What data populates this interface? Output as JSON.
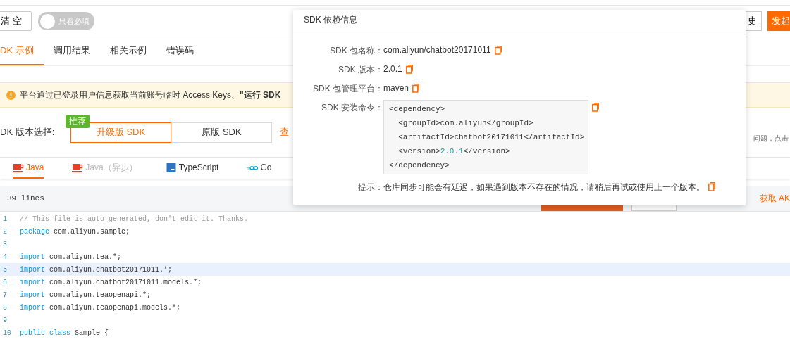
{
  "toolbar": {
    "clear_button": "清 空",
    "toggle": {
      "label": "只看必填",
      "on": false
    },
    "history_button": "史",
    "send_button": "发起"
  },
  "tabs": [
    {
      "label": "DK 示例",
      "selected": true
    },
    {
      "label": "调用结果",
      "selected": false
    },
    {
      "label": "相关示例",
      "selected": false
    },
    {
      "label": "错误码",
      "selected": false
    }
  ],
  "alert": {
    "text": "平台通过已登录用户信息获取当前账号临时 Access Keys、**\"运行 SDK**"
  },
  "sdk_version": {
    "label": "DK 版本选择:",
    "badge": "推荐",
    "options": [
      {
        "label": "升级版 SDK",
        "selected": true
      },
      {
        "label": "原版 SDK",
        "selected": false
      }
    ],
    "link": "查",
    "note": "问题，点击"
  },
  "languages": [
    {
      "label": "Java",
      "selected": true,
      "disabled": false,
      "kind": "java"
    },
    {
      "label": "Java（异步）",
      "selected": false,
      "disabled": true,
      "kind": "java"
    },
    {
      "label": "TypeScript",
      "selected": false,
      "disabled": false,
      "kind": "typescript"
    },
    {
      "label": "Go",
      "selected": false,
      "disabled": false,
      "kind": "go"
    }
  ],
  "code_header": {
    "line_count": "39 lines",
    "get_ak_link": "获取 AK"
  },
  "code": [
    {
      "number": "1",
      "highlighted": false,
      "tokens": [
        {
          "kind": "comment",
          "text": "// This file is auto-generated, don't edit it. Thanks."
        }
      ]
    },
    {
      "number": "2",
      "highlighted": false,
      "tokens": [
        {
          "kind": "keyword",
          "text": "package"
        },
        {
          "kind": "plain",
          "text": " com.aliyun.sample;"
        }
      ]
    },
    {
      "number": "3",
      "highlighted": false
    },
    {
      "number": "4",
      "highlighted": false,
      "tokens": [
        {
          "kind": "keyword",
          "text": "import"
        },
        {
          "kind": "plain",
          "text": " com.aliyun.tea.*;"
        }
      ]
    },
    {
      "number": "5",
      "highlighted": true,
      "tokens": [
        {
          "kind": "keyword",
          "text": "import"
        },
        {
          "kind": "plain",
          "text": " com.aliyun.chatbot20171011.*;"
        }
      ]
    },
    {
      "number": "6",
      "highlighted": false,
      "tokens": [
        {
          "kind": "keyword",
          "text": "import"
        },
        {
          "kind": "plain",
          "text": " com.aliyun.chatbot20171011.models.*;"
        }
      ]
    },
    {
      "number": "7",
      "highlighted": false,
      "tokens": [
        {
          "kind": "keyword",
          "text": "import"
        },
        {
          "kind": "plain",
          "text": " com.aliyun.teaopenapi.*;"
        }
      ]
    },
    {
      "number": "8",
      "highlighted": false,
      "tokens": [
        {
          "kind": "keyword",
          "text": "import"
        },
        {
          "kind": "plain",
          "text": " com.aliyun.teaopenapi.models.*;"
        }
      ]
    },
    {
      "number": "9",
      "highlighted": false
    },
    {
      "number": "10",
      "highlighted": false,
      "tokens": [
        {
          "kind": "keyword",
          "text": "public class"
        },
        {
          "kind": "plain",
          "text": " Sample {"
        }
      ]
    }
  ],
  "popover": {
    "title": "SDK 依赖信息",
    "rows": [
      {
        "kind": "text",
        "label": "SDK 包名称：",
        "value": "com.aliyun/chatbot20171011"
      },
      {
        "kind": "text",
        "label": "SDK 版本：",
        "value": "2.0.1"
      },
      {
        "kind": "text",
        "label": "SDK 包管理平台：",
        "value": "maven"
      },
      {
        "kind": "code",
        "label": "SDK 安装命令：",
        "lines": [
          [
            {
              "kind": "plain",
              "text": "<dependency>"
            }
          ],
          [
            {
              "kind": "plain",
              "text": "  <groupId>com.aliyun</groupId>"
            }
          ],
          [
            {
              "kind": "plain",
              "text": "  <artifactId>chatbot20171011</artifactId>"
            }
          ],
          [
            {
              "kind": "plain",
              "text": "  <version>"
            },
            {
              "kind": "number",
              "text": "2.0.1"
            },
            {
              "kind": "plain",
              "text": "</version>"
            }
          ],
          [
            {
              "kind": "plain",
              "text": "</dependency>"
            }
          ]
        ]
      },
      {
        "kind": "text",
        "label": "提示：",
        "value": "仓库同步可能会有延迟，如果遇到版本不存在的情况，请稍后再试或使用上一个版本。"
      }
    ]
  }
}
